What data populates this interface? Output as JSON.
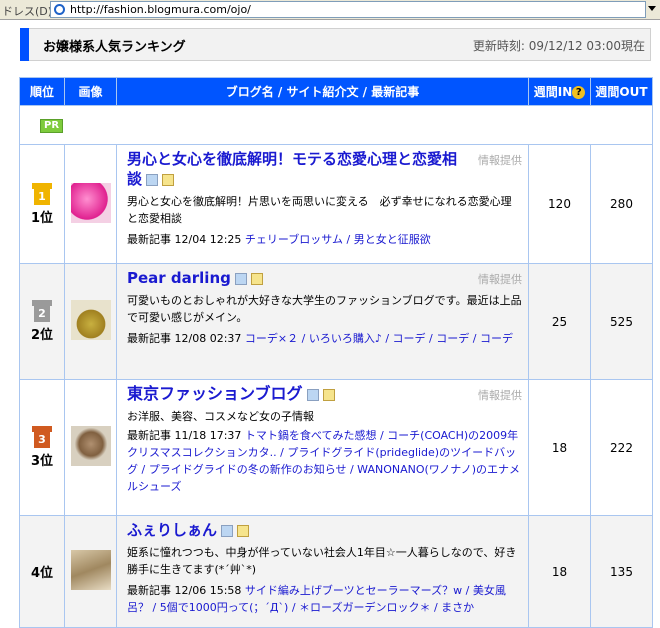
{
  "address_bar": {
    "label": "ドレス(D)",
    "url": "http://fashion.blogmura.com/ojo/"
  },
  "header": {
    "title": "お嬢様系人気ランキング",
    "updated": "更新時刻: 09/12/12 03:00現在"
  },
  "table": {
    "columns": {
      "rank": "順位",
      "image": "画像",
      "blog": "ブログ名 / サイト紹介文 / 最新記事",
      "in": "週間IN",
      "in_help": "?",
      "out": "週間OUT"
    },
    "pr": "PR",
    "provider_label": "情報提供",
    "latest_label": "最新記事",
    "rows": [
      {
        "place": "1位",
        "medal": "1",
        "name": "男心と女心を徹底解明！モテる恋愛心理と恋愛相談",
        "desc": "男心と女心を徹底解明！片思いを両思いに変える　必ず幸せになれる恋愛心理と恋愛相談",
        "time": "12/04 12:25",
        "links": "チェリーブロッサム / 男と女と征服欲",
        "in": "120",
        "out": "280"
      },
      {
        "place": "2位",
        "medal": "2",
        "name": "Pear darling",
        "desc": "可愛いものとおしゃれが大好きな大学生のファッションブログです。最近は上品で可愛い感じがメイン。",
        "time": "12/08 02:37",
        "links": "コーデ×２ / いろいろ購入♪ / コーデ / コーデ / コーデ",
        "in": "25",
        "out": "525"
      },
      {
        "place": "3位",
        "medal": "3",
        "name": "東京ファッションブログ",
        "desc": "お洋服、美容、コスメなど女の子情報",
        "time": "11/18 17:37",
        "links": "トマト鍋を食べてみた感想 / コーチ(COACH)の2009年クリスマスコレクションカタ.. / プライドグライド(prideglide)のツイードバッグ / プライドグライドの冬の新作のお知らせ / WANONANO(ワノナノ)のエナメルシューズ",
        "in": "18",
        "out": "222"
      },
      {
        "place": "4位",
        "medal": "",
        "name": "ふぇりしぁん",
        "desc": "姫系に憧れつつも、中身が伴っていない社会人1年目☆一人暮らしなので、好き勝手に生きてます(*´艸`*)",
        "time": "12/06 15:58",
        "links": "サイド編み上げブーツとセーラーマーズ？w / 美女風呂？ / 5個で1000円って(；´Д`) / ＊ローズガーデンロック＊ / まさか",
        "in": "18",
        "out": "135"
      }
    ]
  },
  "colors": {
    "accent": "#0055ff",
    "link": "#1a1ad0",
    "gold": "#f0b400",
    "silver": "#9a9a9a",
    "bronze": "#d05a20"
  }
}
